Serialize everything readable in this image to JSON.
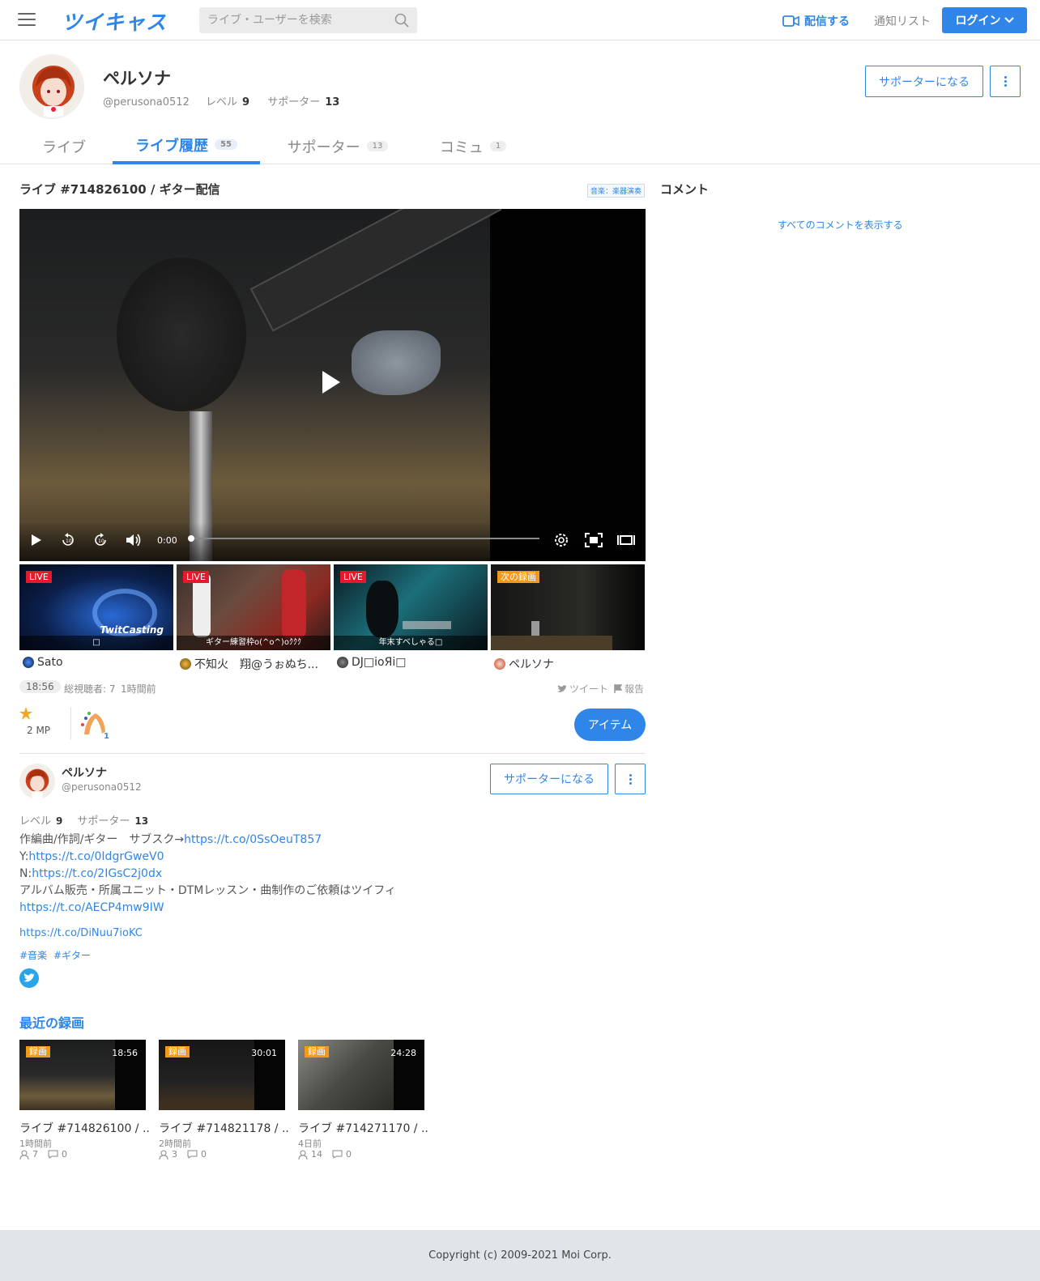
{
  "header": {
    "logo": "ツイキャス",
    "search_placeholder": "ライブ・ユーザーを検索",
    "broadcast": "配信する",
    "notify": "通知リスト",
    "login": "ログイン"
  },
  "profile": {
    "name": "ペルソナ",
    "handle": "@perusona0512",
    "level_label": "レベル",
    "level": "9",
    "supporter_label": "サポーター",
    "supporters": "13",
    "become_supporter": "サポーターになる"
  },
  "tabs": [
    {
      "label": "ライブ",
      "count": ""
    },
    {
      "label": "ライブ履歴",
      "count": "55"
    },
    {
      "label": "サポーター",
      "count": "13"
    },
    {
      "label": "コミュ",
      "count": "1"
    }
  ],
  "live": {
    "title": "ライブ #714826100 / ギター配信",
    "category": "音楽：楽器演奏",
    "time": "0:00",
    "progress": 0
  },
  "comments": {
    "title": "コメント",
    "show_all": "すべてのコメントを表示する"
  },
  "related": [
    {
      "badge": "LIVE",
      "caption": "□",
      "user": "Sato"
    },
    {
      "badge": "LIVE",
      "caption": "ギター練習枠o(^o^)oｸｸｸ",
      "user": "不知火　翔@うぉぬち..."
    },
    {
      "badge": "LIVE",
      "caption": "年末すべしゃる□",
      "user": "DJ□ioЯi□"
    },
    {
      "badge": "次の録画",
      "caption": "",
      "user": "ペルソナ"
    }
  ],
  "stats": {
    "duration": "18:56",
    "viewers": "総視聴者: 7",
    "ago": "1時間前",
    "tweet": "ツイート",
    "report": "報告",
    "mp": "2 MP",
    "item_count": "1",
    "item_button": "アイテム"
  },
  "owner": {
    "name": "ペルソナ",
    "handle": "@perusona0512",
    "level_label": "レベル",
    "level": "9",
    "supporter_label": "サポーター",
    "supporters": "13",
    "become_supporter": "サポーターになる",
    "bio_line1_text": "作編曲/作詞/ギター　サブスク→",
    "bio_line1_link": "https://t.co/0SsOeuT857",
    "bio_line2_text": "Y:",
    "bio_line2_link": "https://t.co/0IdgrGweV0",
    "bio_line3_text": "N:",
    "bio_line3_link": "https://t.co/2IGsC2j0dx",
    "bio_line4_text": "アルバム販売・所属ユニット・DTMレッスン・曲制作のご依頼はツイフィ",
    "bio_line5_link": "https://t.co/AECP4mw9IW",
    "extra_link": "https://t.co/DiNuu7ioKC",
    "tag1": "#音楽",
    "tag2": "#ギター"
  },
  "recent": {
    "title": "最近の録画",
    "items": [
      {
        "badge": "録画",
        "duration": "18:56",
        "title": "ライブ #714826100 / ...",
        "ago": "1時間前",
        "viewers": "7",
        "comments": "0"
      },
      {
        "badge": "録画",
        "duration": "30:01",
        "title": "ライブ #714821178 / ...",
        "ago": "2時間前",
        "viewers": "3",
        "comments": "0"
      },
      {
        "badge": "録画",
        "duration": "24:28",
        "title": "ライブ #714271170 / ...",
        "ago": "4日前",
        "viewers": "14",
        "comments": "0"
      }
    ]
  },
  "footer": {
    "copyright": "Copyright (c) 2009-2021 Moi Corp."
  }
}
